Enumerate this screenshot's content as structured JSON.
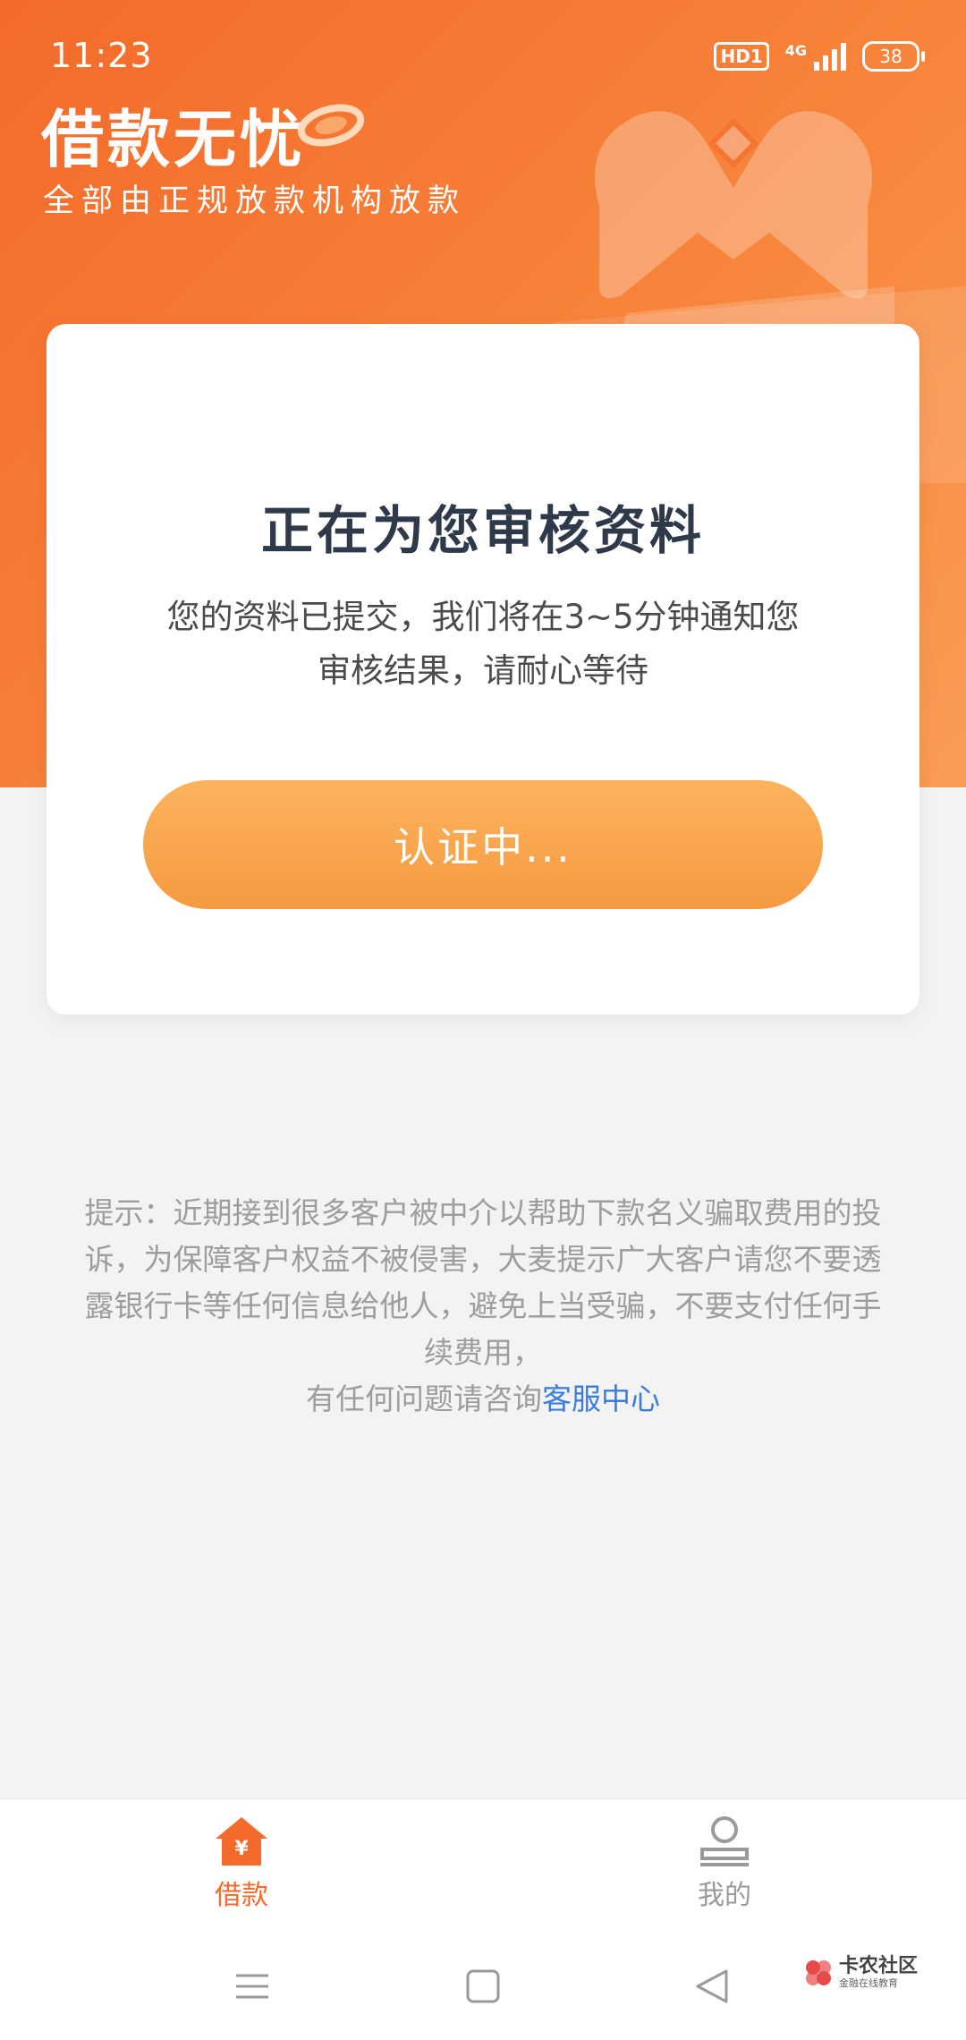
{
  "status_bar": {
    "time": "11:23",
    "hd_badge": "HD1",
    "network": "4G",
    "battery": "38"
  },
  "brand": {
    "title": "借款无忧",
    "subtitle": "全部由正规放款机构放款"
  },
  "review_card": {
    "title": "正在为您审核资料",
    "description": "您的资料已提交，我们将在3~5分钟通知您审核结果，请耐心等待",
    "status_button": "认证中..."
  },
  "notice": {
    "text": "提示：近期接到很多客户被中介以帮助下款名义骗取费用的投诉，为保障客户权益不被侵害，大麦提示广大客户请您不要透露银行卡等任何信息给他人，避免上当受骗，不要支付任何手续费用，",
    "contact_prefix": "有任何问题请咨询",
    "contact_link": "客服中心"
  },
  "tabbar": {
    "items": [
      {
        "label": "借款",
        "icon": "loan-house-icon",
        "active": true
      },
      {
        "label": "我的",
        "icon": "user-profile-icon",
        "active": false
      }
    ]
  },
  "watermark": {
    "title": "卡农社区",
    "subtitle": "金融在线教育"
  },
  "colors": {
    "brand_orange": "#f46a2a",
    "button_orange": "#f8a14a",
    "link_blue": "#3b7ddb"
  }
}
